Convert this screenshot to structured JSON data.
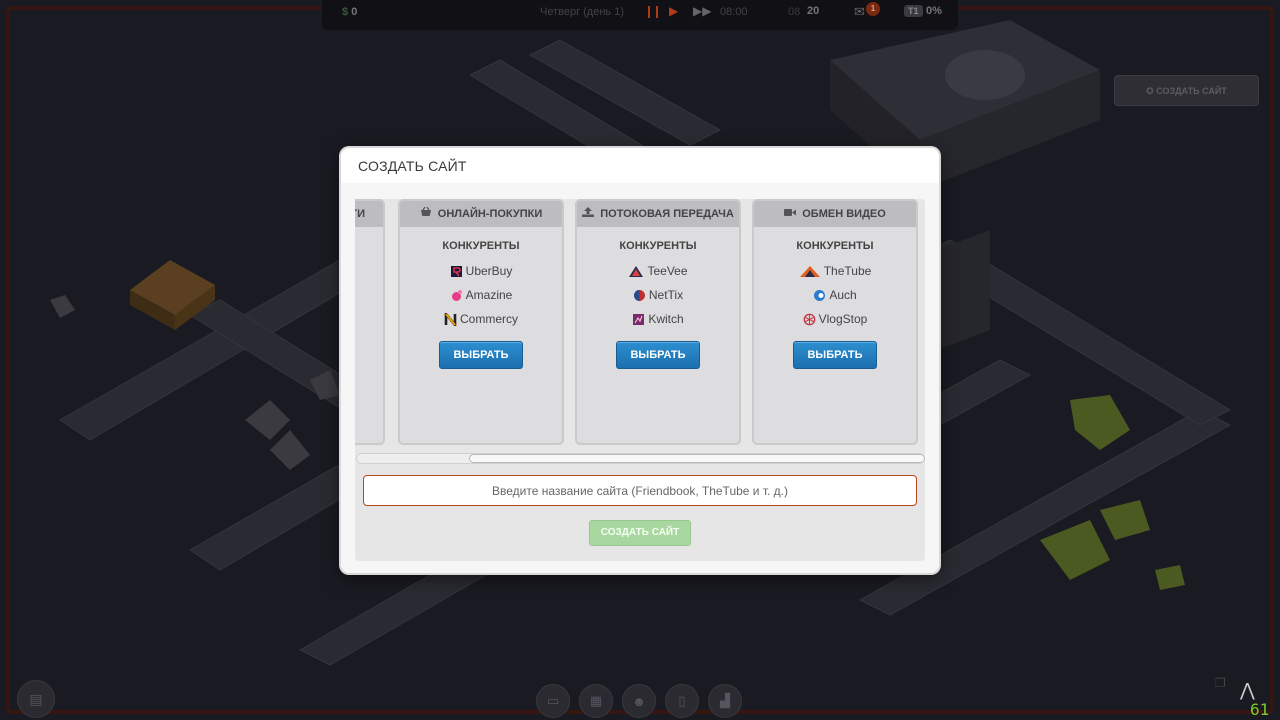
{
  "hud": {
    "money_symbol": "$",
    "money": "0",
    "day": "Четверг (день 1)",
    "clock": "08:00",
    "users_label": "08",
    "users": "20",
    "mail_badge": "1",
    "tier": "T1",
    "percent": "0%"
  },
  "top_right": {
    "create_site_label": "✪ СОЗДАТЬ САЙТ"
  },
  "dialog": {
    "title": "СОЗДАТЬ САЙТ",
    "partial_card_title": "ТИ",
    "cards": [
      {
        "title": "ОНЛАЙН-ПОКУПКИ",
        "icon": "basket-icon",
        "competitors_label": "КОНКУРЕНТЫ",
        "competitors": [
          {
            "name": "UberBuy",
            "icon": "uberbuy-logo-icon",
            "color": "#c0392b"
          },
          {
            "name": "Amazine",
            "icon": "amazine-logo-icon",
            "color": "#e83b8a"
          },
          {
            "name": "Commercy",
            "icon": "commercy-logo-icon",
            "color": "#f0a000"
          }
        ],
        "button": "ВЫБРАТЬ"
      },
      {
        "title": "ПОТОКОВАЯ ПЕРЕДАЧА",
        "icon": "upload-icon",
        "competitors_label": "КОНКУРЕНТЫ",
        "competitors": [
          {
            "name": "TeeVee",
            "icon": "teevee-logo-icon",
            "color": "#d03a3a"
          },
          {
            "name": "NetTix",
            "icon": "nettix-logo-icon",
            "color": "#c03030"
          },
          {
            "name": "Kwitch",
            "icon": "kwitch-logo-icon",
            "color": "#8a3a8a"
          }
        ],
        "button": "ВЫБРАТЬ"
      },
      {
        "title": "ОБМЕН ВИДЕО",
        "icon": "video-camera-icon",
        "competitors_label": "КОНКУРЕНТЫ",
        "competitors": [
          {
            "name": "TheTube",
            "icon": "thetube-logo-icon",
            "color": "#e06020"
          },
          {
            "name": "Auch",
            "icon": "auch-logo-icon",
            "color": "#2a7ad0"
          },
          {
            "name": "VlogStop",
            "icon": "vlogstop-logo-icon",
            "color": "#c83a4a"
          }
        ],
        "button": "ВЫБРАТЬ"
      }
    ],
    "input_placeholder": "Введите название сайта (Friendbook, TheTube и т. д.)",
    "create_button": "СОЗДАТЬ САЙТ"
  },
  "colors": {
    "accent_blue": "#1b6fae",
    "input_border": "#b5481a",
    "create_disabled": "#a8d8a0",
    "fps": "#7acc2a"
  },
  "fps": "61"
}
